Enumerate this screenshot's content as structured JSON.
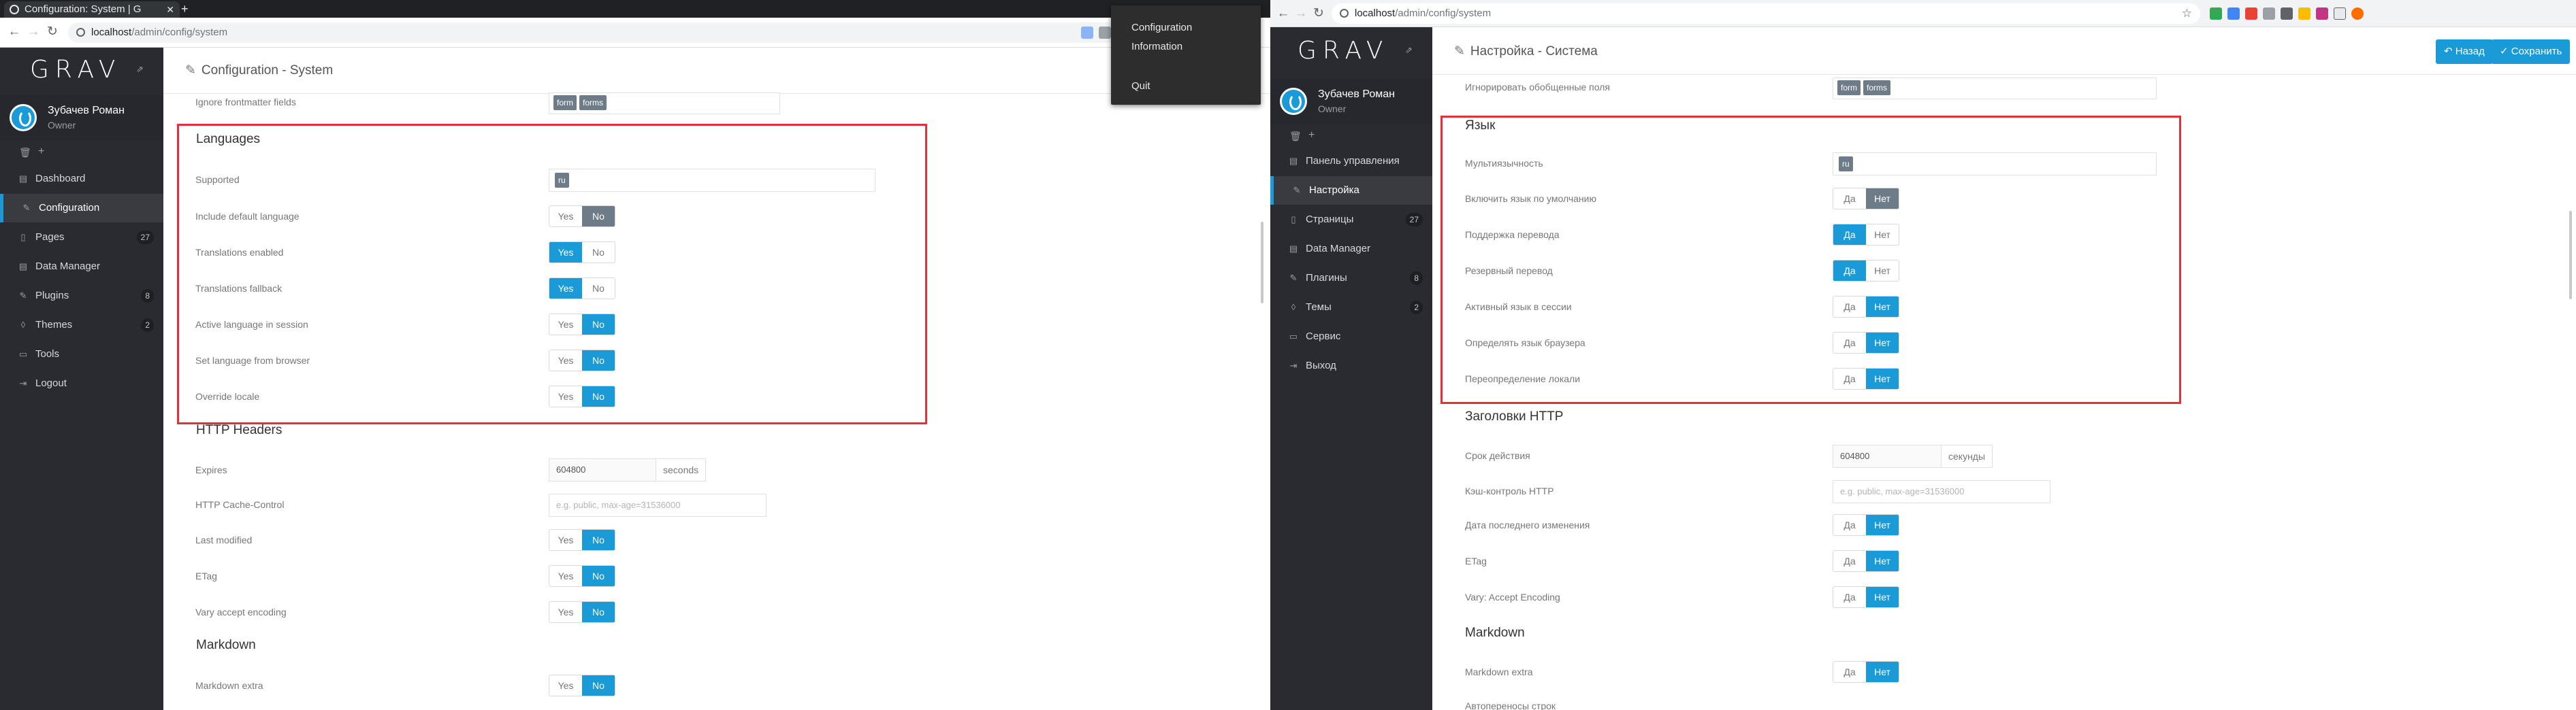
{
  "left": {
    "tab_title": "Configuration: System | G",
    "url_host": "localhost",
    "url_path": "/admin/config/system",
    "logo": "GRAV",
    "user_name": "Зубачев Роман",
    "user_role": "Owner",
    "quick_trash": "🗑",
    "quick_add": "+",
    "nav": [
      {
        "label": "Dashboard",
        "icon": "dashboard-icon",
        "glyph": "▤",
        "count": ""
      },
      {
        "label": "Configuration",
        "icon": "wrench-icon",
        "glyph": "✎",
        "count": ""
      },
      {
        "label": "Pages",
        "icon": "file-icon",
        "glyph": "▯",
        "count": "27"
      },
      {
        "label": "Data Manager",
        "icon": "database-icon",
        "glyph": "▤",
        "count": ""
      },
      {
        "label": "Plugins",
        "icon": "plug-icon",
        "glyph": "✎",
        "count": "8"
      },
      {
        "label": "Themes",
        "icon": "tint-icon",
        "glyph": "◊",
        "count": "2"
      },
      {
        "label": "Tools",
        "icon": "briefcase-icon",
        "glyph": "▭",
        "count": ""
      },
      {
        "label": "Logout",
        "icon": "sign-out-icon",
        "glyph": "⇥",
        "count": ""
      }
    ],
    "page_title": "Configuration - System",
    "dropdown": {
      "item1": "Configuration",
      "item2": "Information",
      "item3": "Quit"
    },
    "top_field_label": "Ignore frontmatter fields",
    "top_field_tags": [
      "form",
      "forms"
    ],
    "languages_heading": "Languages",
    "supported_label": "Supported",
    "supported_tag": "ru",
    "yes": "Yes",
    "no": "No",
    "lang_toggles": [
      {
        "label": "Include default language",
        "value": "no-gray"
      },
      {
        "label": "Translations enabled",
        "value": "yes"
      },
      {
        "label": "Translations fallback",
        "value": "yes"
      },
      {
        "label": "Active language in session",
        "value": "no"
      },
      {
        "label": "Set language from browser",
        "value": "no"
      },
      {
        "label": "Override locale",
        "value": "no"
      }
    ],
    "http_heading": "HTTP Headers",
    "expires_label": "Expires",
    "expires_value": "604800",
    "expires_unit": "seconds",
    "cache_label": "HTTP Cache-Control",
    "cache_placeholder": "e.g. public, max-age=31536000",
    "http_toggles": [
      {
        "label": "Last modified",
        "value": "no"
      },
      {
        "label": "ETag",
        "value": "no"
      },
      {
        "label": "Vary accept encoding",
        "value": "no"
      }
    ],
    "markdown_heading": "Markdown",
    "markdown_extra_label": "Markdown extra",
    "markdown_extra_value": "no"
  },
  "right": {
    "url_host": "localhost",
    "url_path": "/admin/config/system",
    "logo": "GRAV",
    "user_name": "Зубачев Роман",
    "user_role": "Owner",
    "quick_trash": "🗑",
    "quick_add": "+",
    "nav": [
      {
        "label": "Панель управления",
        "icon": "dashboard-icon",
        "glyph": "▤",
        "count": ""
      },
      {
        "label": "Настройка",
        "icon": "wrench-icon",
        "glyph": "✎",
        "count": ""
      },
      {
        "label": "Страницы",
        "icon": "file-icon",
        "glyph": "▯",
        "count": "27"
      },
      {
        "label": "Data Manager",
        "icon": "database-icon",
        "glyph": "▤",
        "count": ""
      },
      {
        "label": "Плагины",
        "icon": "plug-icon",
        "glyph": "✎",
        "count": "8"
      },
      {
        "label": "Темы",
        "icon": "tint-icon",
        "glyph": "◊",
        "count": "2"
      },
      {
        "label": "Сервис",
        "icon": "briefcase-icon",
        "glyph": "▭",
        "count": ""
      },
      {
        "label": "Выход",
        "icon": "sign-out-icon",
        "glyph": "⇥",
        "count": ""
      }
    ],
    "page_title": "Настройка - Система",
    "back_button": "Назад",
    "save_button": "Сохранить",
    "top_field_label": "Игнорировать обобщенные поля",
    "top_field_tags": [
      "form",
      "forms"
    ],
    "languages_heading": "Язык",
    "supported_label": "Мультиязычность",
    "supported_tag": "ru",
    "yes": "Да",
    "no": "Нет",
    "lang_toggles": [
      {
        "label": "Включить язык по умолчанию",
        "value": "no-gray"
      },
      {
        "label": "Поддержка перевода",
        "value": "yes"
      },
      {
        "label": "Резервный перевод",
        "value": "yes"
      },
      {
        "label": "Активный язык в сессии",
        "value": "no"
      },
      {
        "label": "Определять язык браузера",
        "value": "no"
      },
      {
        "label": "Переопределение локали",
        "value": "no"
      }
    ],
    "http_heading": "Заголовки HTTP",
    "expires_label": "Срок действия",
    "expires_value": "604800",
    "expires_unit": "секунды",
    "cache_label": "Кэш-контроль HTTP",
    "cache_placeholder": "e.g. public, max-age=31536000",
    "http_toggles": [
      {
        "label": "Дата последнего изменения",
        "value": "no"
      },
      {
        "label": "ETag",
        "value": "no"
      },
      {
        "label": "Vary: Accept Encoding",
        "value": "no"
      }
    ],
    "markdown_heading": "Markdown",
    "markdown_extra_label": "Markdown extra",
    "markdown_extra_value": "no",
    "next_label": "Автопереносы строк"
  },
  "colors": {
    "accent": "#1a9ad7",
    "sidebar": "#2a2b30",
    "highlight_box": "#e2313a",
    "toggle_gray": "#6e7b88"
  }
}
